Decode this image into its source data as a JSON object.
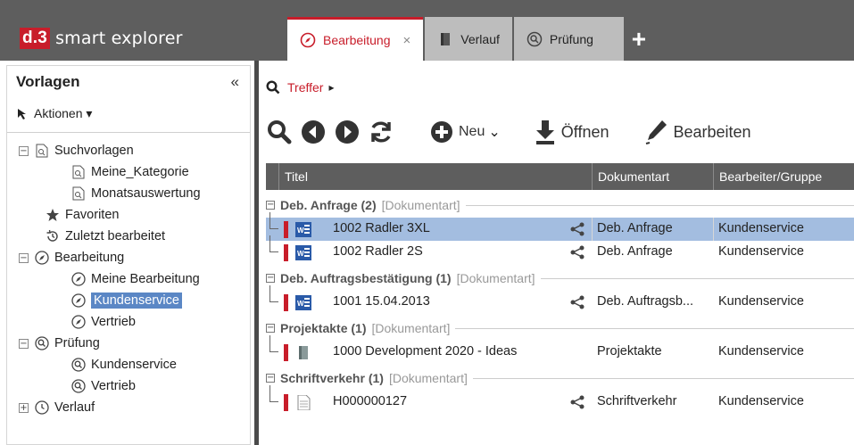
{
  "app": {
    "logo_prefix": "d.3",
    "logo_name": "smart explorer"
  },
  "tabs": [
    {
      "label": "Bearbeitung",
      "icon": "compass-icon",
      "active": true,
      "closable": true,
      "close_symbol": "×"
    },
    {
      "label": "Verlauf",
      "icon": "book-icon",
      "active": false
    },
    {
      "label": "Prüfung",
      "icon": "magnifier-circle-icon",
      "active": false
    }
  ],
  "add_tab_symbol": "+",
  "sidebar": {
    "title": "Vorlagen",
    "collapse_symbol": "«",
    "actions_label": "Aktionen ▾",
    "tree": [
      {
        "label": "Suchvorlagen",
        "icon": "search-doc-icon",
        "expander": "−"
      },
      {
        "label": "Meine_Kategorie",
        "icon": "search-doc-icon"
      },
      {
        "label": "Monatsauswertung",
        "icon": "search-doc-icon"
      },
      {
        "label": "Favoriten",
        "icon": "star-icon"
      },
      {
        "label": "Zuletzt bearbeitet",
        "icon": "history-icon"
      },
      {
        "label": "Bearbeitung",
        "icon": "compass-icon",
        "expander": "−"
      },
      {
        "label": "Meine Bearbeitung",
        "icon": "compass-icon"
      },
      {
        "label": "Kundenservice",
        "icon": "compass-icon",
        "selected": true
      },
      {
        "label": "Vertrieb",
        "icon": "compass-icon"
      },
      {
        "label": "Prüfung",
        "icon": "magnifier-circle-icon",
        "expander": "−"
      },
      {
        "label": "Kundenservice",
        "icon": "magnifier-circle-icon"
      },
      {
        "label": "Vertrieb",
        "icon": "magnifier-circle-icon"
      },
      {
        "label": "Verlauf",
        "icon": "clock-icon",
        "expander": "+"
      }
    ]
  },
  "breadcrumb": {
    "label": "Treffer",
    "arrow": "▸"
  },
  "toolbar": {
    "new_label": "Neu",
    "new_caret": "⌄",
    "open_label": "Öffnen",
    "edit_label": "Bearbeiten"
  },
  "table": {
    "columns": [
      "Titel",
      "Dokumentart",
      "Bearbeiter/Gruppe"
    ],
    "groups": [
      {
        "name": "Deb. Anfrage (2)",
        "type": "[Dokumentart]",
        "rows": [
          {
            "title": "1002  Radler 3XL",
            "icon": "word-doc-icon",
            "doctype": "Deb. Anfrage",
            "editor": "Kundenservice",
            "shared": true,
            "selected": true
          },
          {
            "title": "1002  Radler 2S",
            "icon": "word-doc-icon",
            "doctype": "Deb. Anfrage",
            "editor": "Kundenservice",
            "shared": true,
            "selected": false
          }
        ]
      },
      {
        "name": "Deb. Auftragsbestätigung (1)",
        "type": "[Dokumentart]",
        "rows": [
          {
            "title": "1001   15.04.2013",
            "icon": "word-doc-icon",
            "doctype": "Deb. Auftragsb...",
            "editor": "Kundenservice",
            "shared": true,
            "selected": false
          }
        ]
      },
      {
        "name": "Projektakte (1)",
        "type": "[Dokumentart]",
        "rows": [
          {
            "title": "1000  Development 2020 - Ideas",
            "icon": "binder-icon",
            "doctype": "Projektakte",
            "editor": "Kundenservice",
            "shared": false,
            "selected": false
          }
        ]
      },
      {
        "name": "Schriftverkehr (1)",
        "type": "[Dokumentart]",
        "rows": [
          {
            "title": "H000000127",
            "icon": "blank-doc-icon",
            "doctype": "Schriftverkehr",
            "editor": "Kundenservice",
            "shared": true,
            "selected": false
          }
        ]
      }
    ]
  },
  "colors": {
    "accent": "#c81d2a",
    "topbar": "#5e5e5e",
    "selection": "#a3bde0",
    "tree_selection": "#5b87c5"
  }
}
